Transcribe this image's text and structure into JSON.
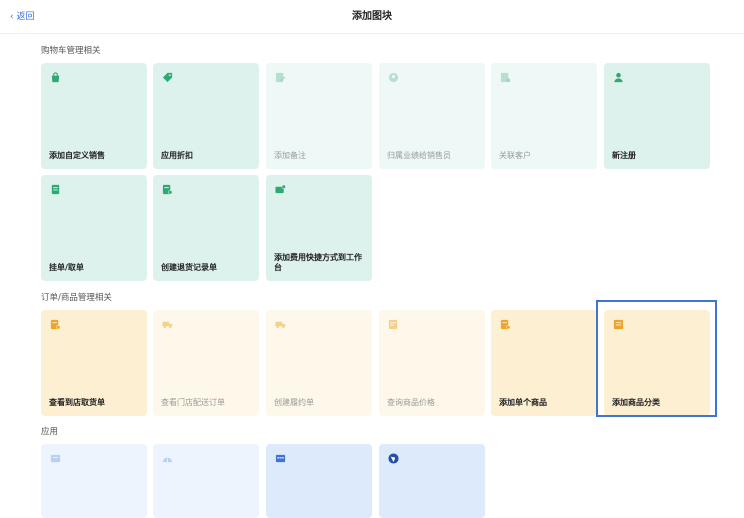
{
  "header": {
    "back_label": "‹ 返回",
    "title": "添加图块"
  },
  "sections": {
    "cart": {
      "title": "购物车管理相关",
      "tiles": [
        {
          "label": "添加自定义销售",
          "icon": "shopping-bag-icon"
        },
        {
          "label": "应用折扣",
          "icon": "tag-icon"
        },
        {
          "label": "添加备注",
          "icon": "edit-note-icon"
        },
        {
          "label": "归属业绩给销售员",
          "icon": "user-circle-icon"
        },
        {
          "label": "关联客户",
          "icon": "contact-card-icon"
        },
        {
          "label": "新注册",
          "icon": "person-icon"
        },
        {
          "label": "挂单/取单",
          "icon": "document-icon"
        },
        {
          "label": "创建退货记录单",
          "icon": "return-receipt-icon"
        },
        {
          "label": "添加费用快捷方式到工作台",
          "icon": "fee-shortcut-icon"
        }
      ]
    },
    "orders": {
      "title": "订单/商品管理相关",
      "tiles": [
        {
          "label": "查看到店取货单",
          "icon": "pickup-order-icon"
        },
        {
          "label": "查看门店配送订单",
          "icon": "delivery-truck-icon"
        },
        {
          "label": "创建履约单",
          "icon": "fulfillment-truck-icon"
        },
        {
          "label": "查询商品价格",
          "icon": "price-query-icon"
        },
        {
          "label": "添加单个商品",
          "icon": "add-product-icon"
        },
        {
          "label": "添加商品分类",
          "icon": "category-icon"
        }
      ]
    },
    "apps": {
      "title": "应用",
      "tiles": [
        {
          "label": "",
          "icon": "app-document-icon"
        },
        {
          "label": "",
          "icon": "app-chart-icon"
        },
        {
          "label": "",
          "icon": "app-calendar-icon"
        },
        {
          "label": "",
          "icon": "app-globe-icon"
        }
      ]
    }
  },
  "colors": {
    "accent": "#3f73d6",
    "green_tile": "#ddf2ec",
    "orange_tile": "#fdf0d2",
    "blue_tile": "#ddeafc"
  }
}
